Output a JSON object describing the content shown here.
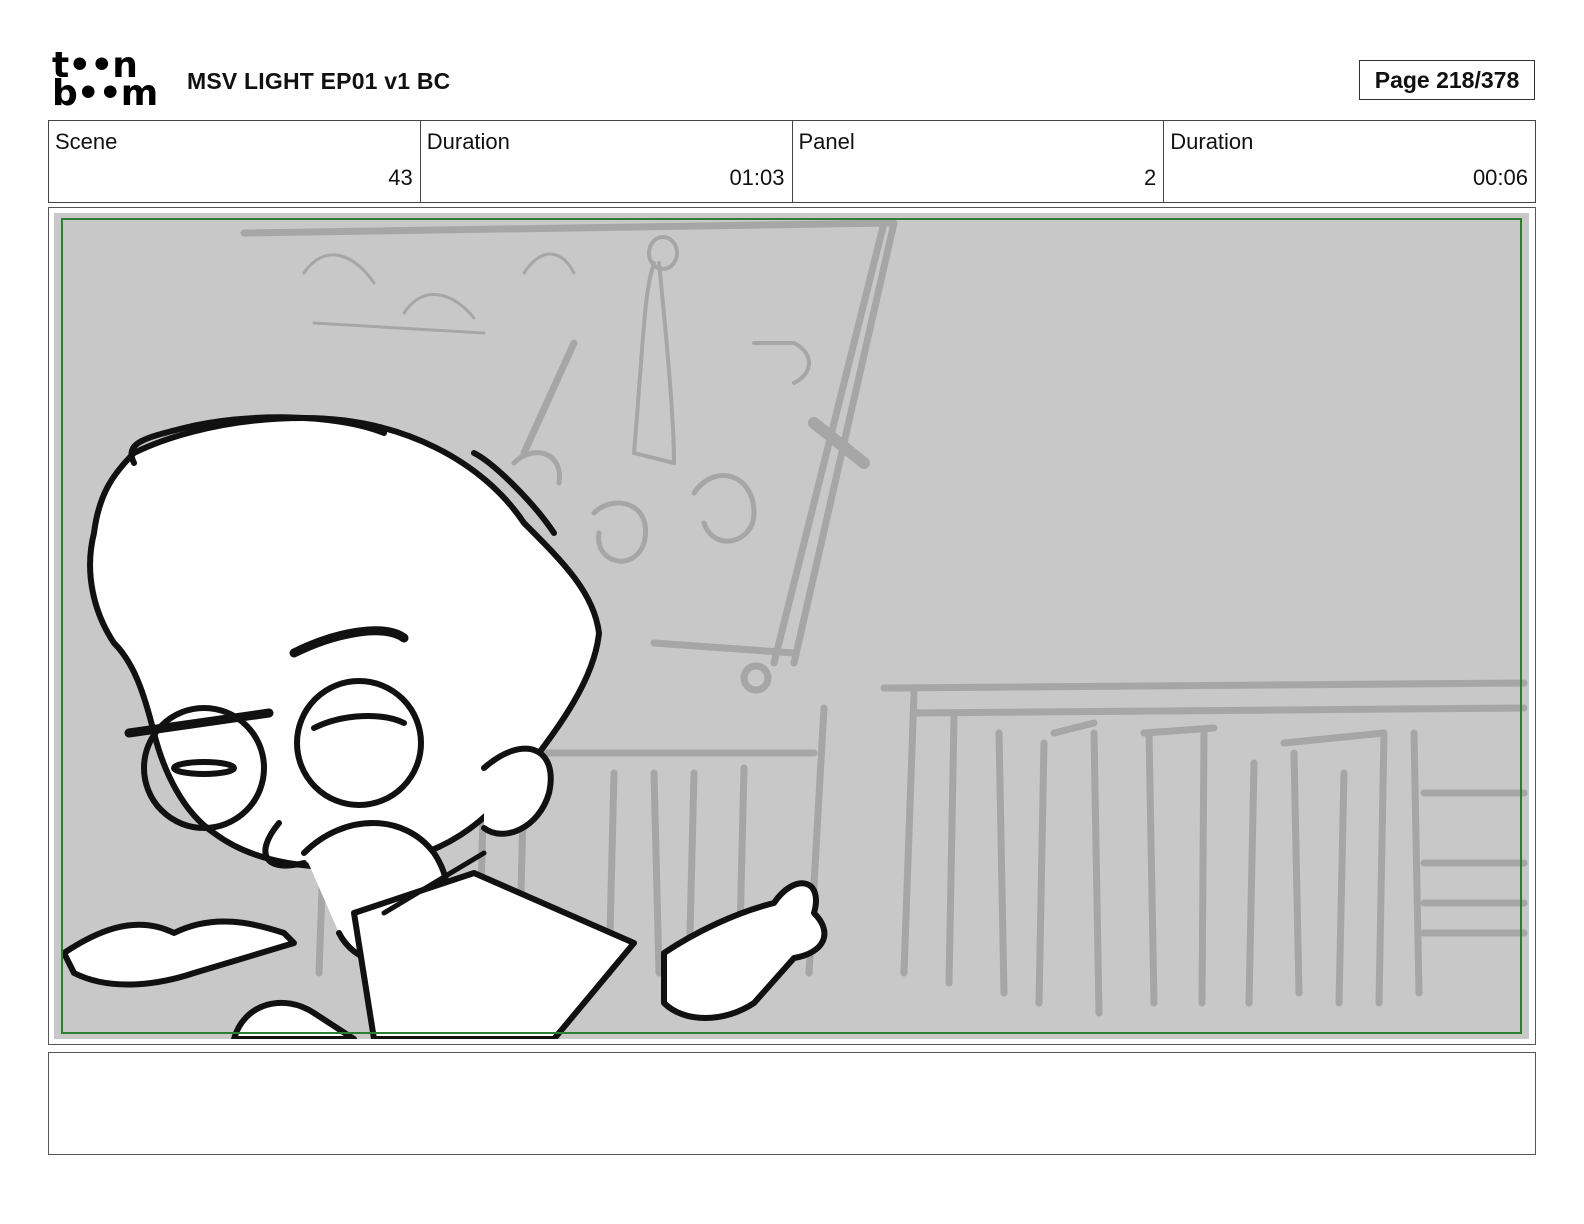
{
  "header": {
    "logo_line1": "t••n",
    "logo_line2": "b••m",
    "title": "MSV LIGHT EP01 v1 BC",
    "page_label": "Page 218/378"
  },
  "info": [
    {
      "label": "Scene",
      "value": "43"
    },
    {
      "label": "Duration",
      "value": "01:03"
    },
    {
      "label": "Panel",
      "value": "2"
    },
    {
      "label": "Duration",
      "value": "00:06"
    }
  ],
  "panel": {
    "background_color": "#c8c8c8",
    "safe_frame_color": "#2e7d32",
    "sketch_line_color": "#111111",
    "background_sketch_color": "#a6a6a6"
  },
  "notes": {
    "text": ""
  }
}
